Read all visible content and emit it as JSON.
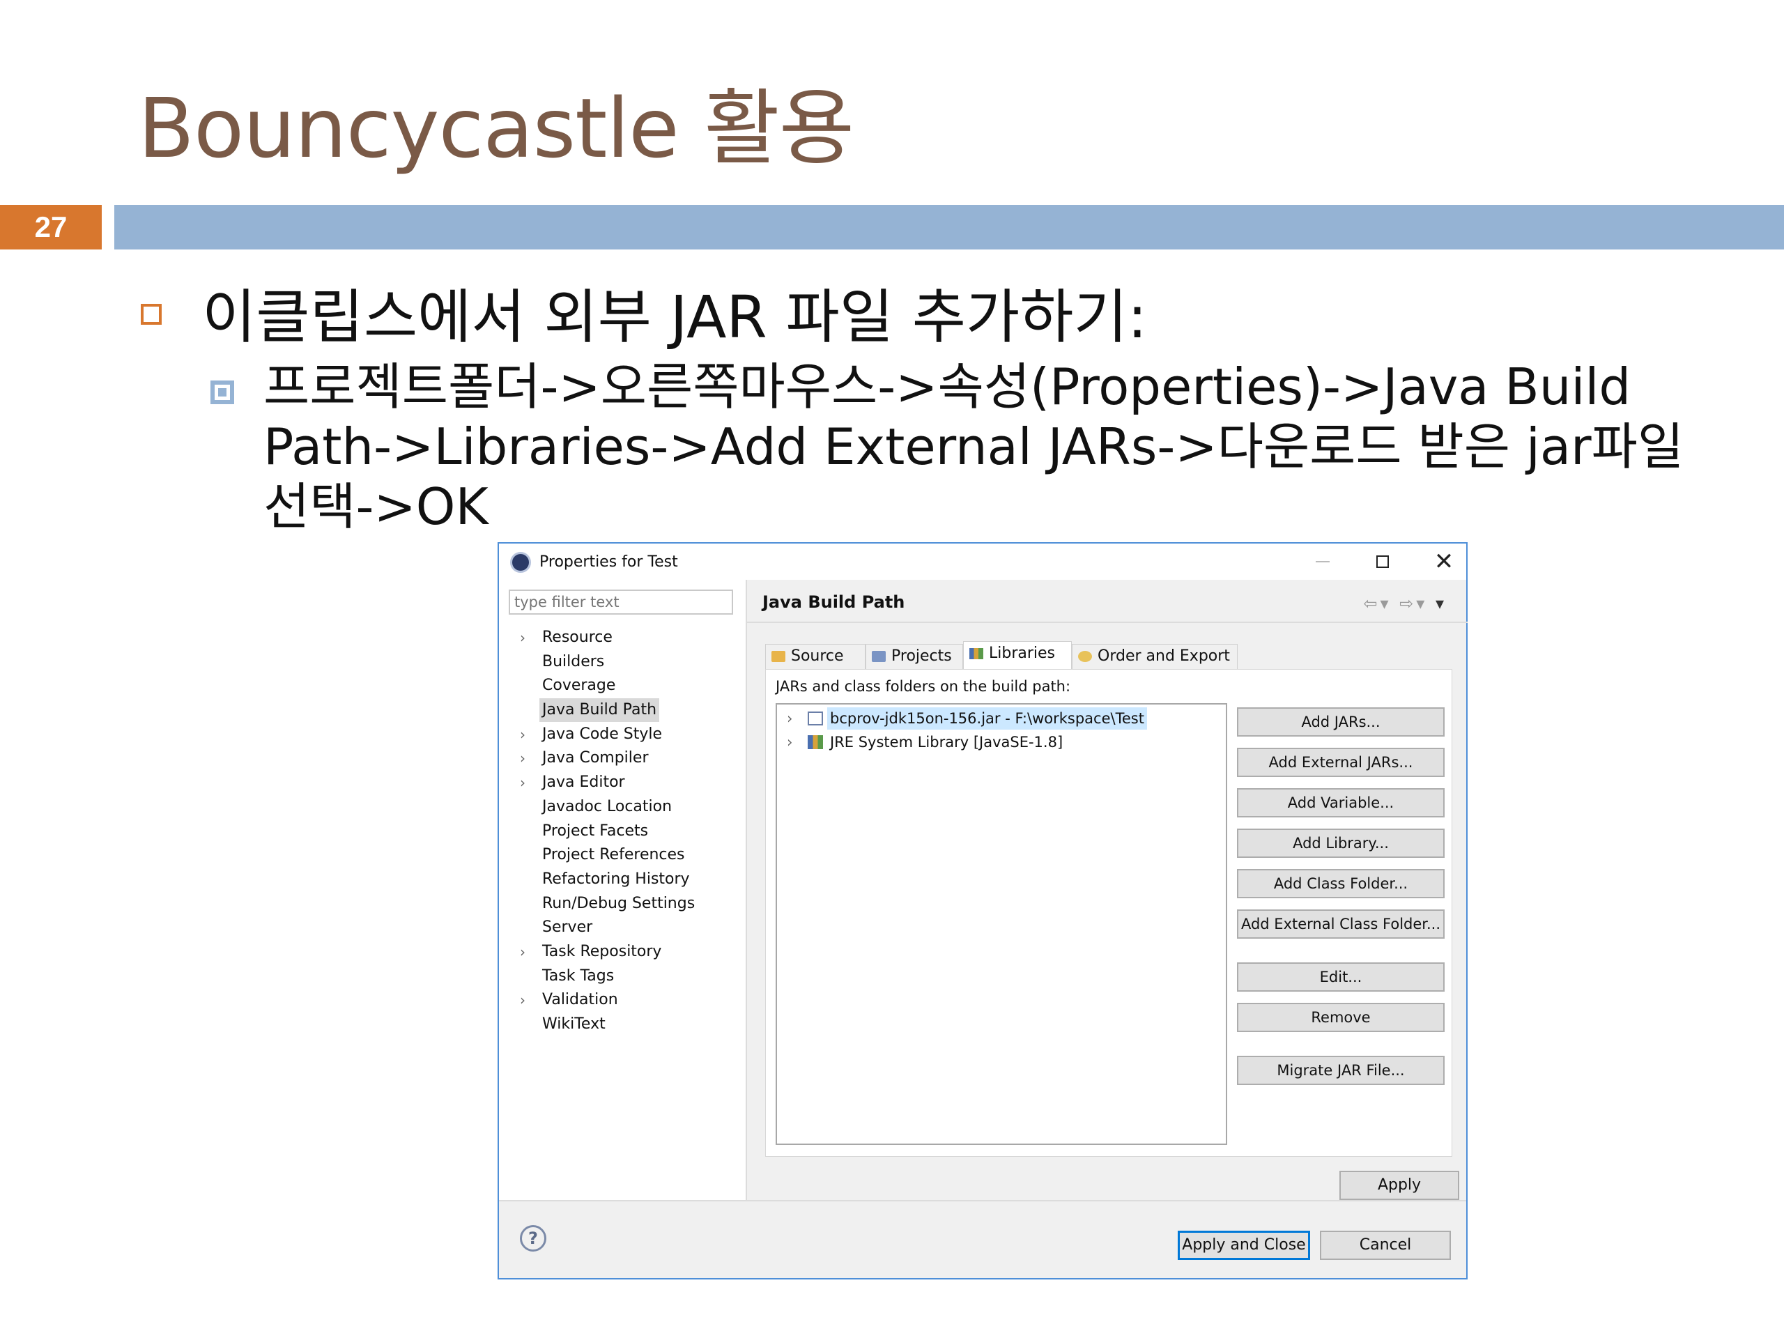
{
  "slide": {
    "title": "Bouncycastle 활용",
    "page_number": "27",
    "bullet1": "이클립스에서 외부 JAR 파일 추가하기:",
    "bullet2": "프로젝트폴더->오른쪽마우스->속성(Properties)->Java Build Path->Libraries->Add External JARs->다운로드 받은 jar파일 선택->OK",
    "colors": {
      "title": "#7a5a47",
      "accent": "#d8772e",
      "bar": "#95b3d4"
    }
  },
  "dialog": {
    "title": "Properties for Test",
    "filter_placeholder": "type filter text",
    "tree": [
      {
        "label": "Resource",
        "expandable": true
      },
      {
        "label": "Builders",
        "expandable": false
      },
      {
        "label": "Coverage",
        "expandable": false
      },
      {
        "label": "Java Build Path",
        "expandable": false,
        "selected": true
      },
      {
        "label": "Java Code Style",
        "expandable": true
      },
      {
        "label": "Java Compiler",
        "expandable": true
      },
      {
        "label": "Java Editor",
        "expandable": true
      },
      {
        "label": "Javadoc Location",
        "expandable": false
      },
      {
        "label": "Project Facets",
        "expandable": false
      },
      {
        "label": "Project References",
        "expandable": false
      },
      {
        "label": "Refactoring History",
        "expandable": false
      },
      {
        "label": "Run/Debug Settings",
        "expandable": false
      },
      {
        "label": "Server",
        "expandable": false
      },
      {
        "label": "Task Repository",
        "expandable": true
      },
      {
        "label": "Task Tags",
        "expandable": false
      },
      {
        "label": "Validation",
        "expandable": true
      },
      {
        "label": "WikiText",
        "expandable": false
      }
    ],
    "panel_title": "Java Build Path",
    "tabs": [
      {
        "label": "Source",
        "icon": "source-folder-icon"
      },
      {
        "label": "Projects",
        "icon": "projects-icon"
      },
      {
        "label": "Libraries",
        "icon": "libraries-icon",
        "active": true
      },
      {
        "label": "Order and Export",
        "icon": "order-export-icon"
      }
    ],
    "list_caption": "JARs and class folders on the build path:",
    "libraries": [
      {
        "label": "bcprov-jdk15on-156.jar - F:\\workspace\\Test",
        "icon": "jar-icon",
        "selected": true
      },
      {
        "label": "JRE System Library [JavaSE-1.8]",
        "icon": "library-icon"
      }
    ],
    "side_buttons": [
      "Add JARs...",
      "Add External JARs...",
      "Add Variable...",
      "Add Library...",
      "Add Class Folder...",
      "Add External Class Folder...",
      "Edit...",
      "Remove",
      "Migrate JAR File..."
    ],
    "apply_label": "Apply",
    "apply_close_label": "Apply and Close",
    "cancel_label": "Cancel",
    "help_symbol": "?"
  }
}
